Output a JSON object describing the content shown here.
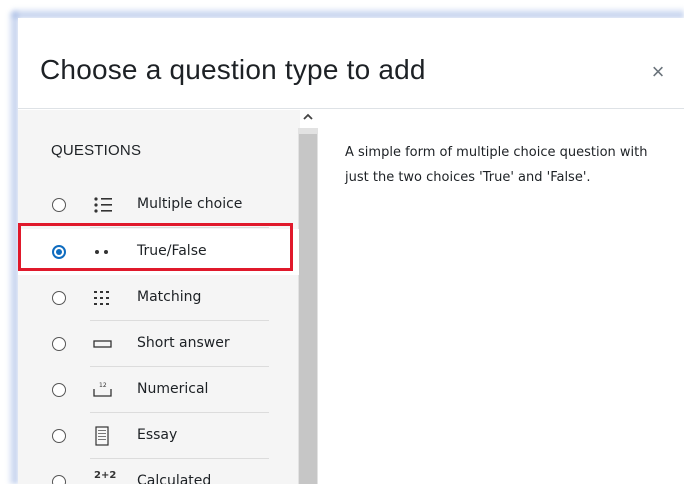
{
  "dialog": {
    "title": "Choose a question type to add",
    "close_label": "×"
  },
  "questions": {
    "heading": "QUESTIONS",
    "items": [
      {
        "label": "Multiple choice",
        "icon": "multichoice-icon",
        "selected": false
      },
      {
        "label": "True/False",
        "icon": "truefalse-icon",
        "selected": true
      },
      {
        "label": "Matching",
        "icon": "matching-icon",
        "selected": false
      },
      {
        "label": "Short answer",
        "icon": "shortanswer-icon",
        "selected": false
      },
      {
        "label": "Numerical",
        "icon": "numerical-icon",
        "selected": false
      },
      {
        "label": "Essay",
        "icon": "essay-icon",
        "selected": false
      },
      {
        "label": "Calculated",
        "icon": "calculated-icon",
        "selected": false
      }
    ],
    "calculated_icon_text": "2+2",
    "numerical_icon_text": "12"
  },
  "description": "A simple form of multiple choice question with just the two choices 'True' and 'False'.",
  "colors": {
    "accent": "#0f6cbf",
    "highlight": "#e0192b"
  }
}
